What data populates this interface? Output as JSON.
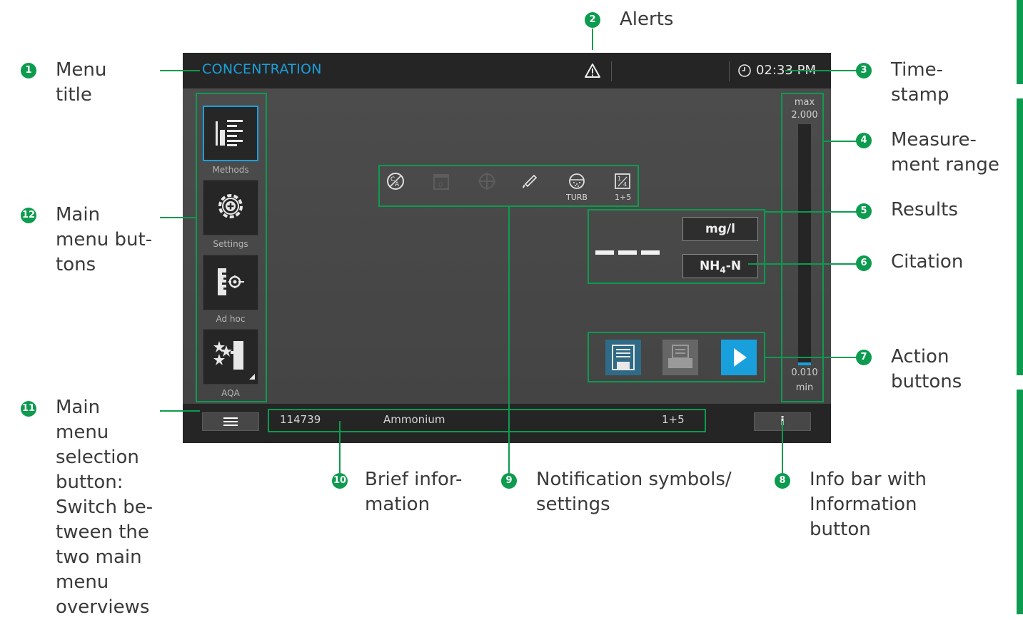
{
  "screen": {
    "menu_title": "CONCENTRATION",
    "time": "02:33 PM",
    "main_menu": [
      {
        "label": "Methods",
        "icon": "methods-icon",
        "active": true
      },
      {
        "label": "Settings",
        "icon": "settings-gear-icon",
        "active": false
      },
      {
        "label": "Ad hoc",
        "icon": "ad-hoc-icon",
        "active": false
      },
      {
        "label": "AQA",
        "icon": "aqa-stars-icon",
        "active": false
      }
    ],
    "notifications": {
      "turb_label": "TURB",
      "dilution_label": "1+5"
    },
    "results": {
      "value": "- - -",
      "unit": "mg/l",
      "citation_main": "NH",
      "citation_sub": "4",
      "citation_tail": "-N"
    },
    "range": {
      "max_label": "max",
      "max_value": "2.000",
      "min_value": "0.010",
      "min_label": "min"
    },
    "info_bar": {
      "method_number": "114739",
      "method_name": "Ammonium",
      "dilution": "1+5",
      "info_button": "i"
    },
    "colors": {
      "accent": "#19a0dc",
      "annotation_green": "#0d9b4f"
    }
  },
  "annotations": [
    {
      "number": "1",
      "text": "Menu\ntitle"
    },
    {
      "number": "2",
      "text": "Alerts"
    },
    {
      "number": "3",
      "text": "Time-\nstamp"
    },
    {
      "number": "4",
      "text": "Measure-\nment range"
    },
    {
      "number": "5",
      "text": "Results"
    },
    {
      "number": "6",
      "text": "Citation"
    },
    {
      "number": "7",
      "text": "Action\nbuttons"
    },
    {
      "number": "8",
      "text": "Info bar with\nInformation\nbutton"
    },
    {
      "number": "9",
      "text": "Notification symbols/\nsettings"
    },
    {
      "number": "10",
      "text": "Brief infor-\nmation"
    },
    {
      "number": "11",
      "text": "Main\nmenu\nselection\nbutton:\nSwitch be-\ntween the\ntwo main\nmenu\noverviews"
    },
    {
      "number": "12",
      "text": "Main\nmenu but-\ntons"
    }
  ]
}
